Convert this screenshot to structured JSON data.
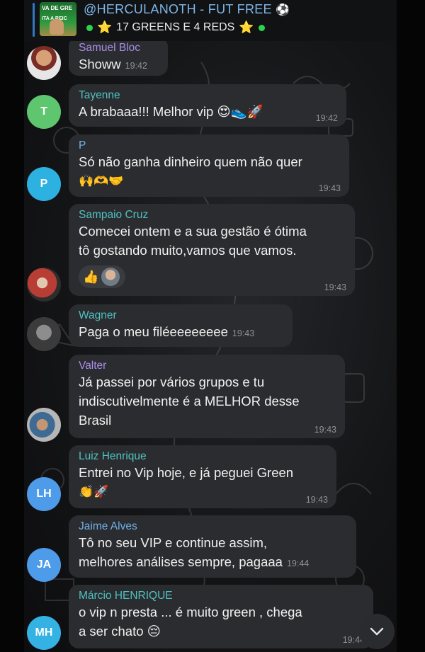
{
  "header": {
    "title": "@HERCULANOTH - FUT FREE",
    "title_icon": "soccer-ball-icon",
    "subtitle": "17 GREENS E 4 REDS",
    "avatar_line1": "VA DE GRE",
    "avatar_line2": "ITA A REIC"
  },
  "messages": [
    {
      "name": "Samuel Bloc",
      "text": [
        "Showw"
      ],
      "time": "19:42",
      "avatar": "photo"
    },
    {
      "name": "Tayenne",
      "text": [
        "A brabaaa!!! Melhor vip 😍👟🚀"
      ],
      "time": "19:42",
      "avatar": "T"
    },
    {
      "name": "P",
      "text": [
        "Só não ganha dinheiro quem não quer",
        "🙌🫶🤝"
      ],
      "time": "19:43",
      "avatar": "P"
    },
    {
      "name": "Sampaio Cruz",
      "text": [
        "Comecei ontem e a sua gestão é ótima",
        "tô gostando muito,vamos que vamos."
      ],
      "time": "19:43",
      "avatar": "photo",
      "reaction": "👍"
    },
    {
      "name": "Wagner",
      "text": [
        "Paga o meu filéeeeeeeee"
      ],
      "time": "19:43",
      "avatar": "photo"
    },
    {
      "name": "Valter",
      "text": [
        "Já passei por vários grupos e tu",
        "indiscutivelmente é a MELHOR desse",
        "Brasil"
      ],
      "time": "19:43",
      "avatar": "photo"
    },
    {
      "name": "Luiz Henrique",
      "text": [
        "Entrei no Vip hoje, e já peguei Green",
        "👏🚀"
      ],
      "time": "19:43",
      "avatar": "LH"
    },
    {
      "name": "Jaime Alves",
      "text": [
        "Tô no seu VIP e continue assim,",
        "melhores análises sempre, pagaaa"
      ],
      "time": "19:44",
      "avatar": "JA"
    },
    {
      "name": "Márcio HENRIQUE",
      "text": [
        "o vip n presta ... é muito green , chega",
        "a ser chato 😔"
      ],
      "time": "19:44",
      "avatar": "MH"
    }
  ],
  "colors": {
    "bubble": "#2b2c2f",
    "background": "#141517",
    "name_blue": "#6fb1e8",
    "name_teal": "#4fc2c0",
    "name_violet": "#a98de8",
    "online_dot": "#2bd44a"
  }
}
